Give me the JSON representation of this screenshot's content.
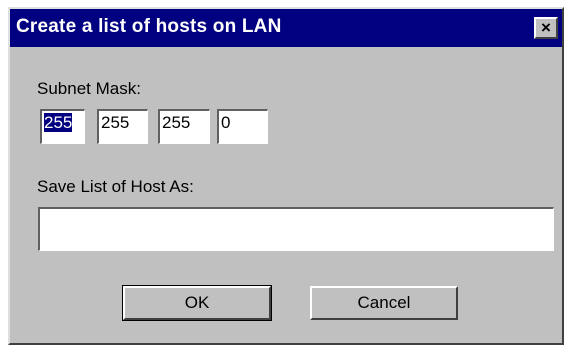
{
  "window": {
    "title": "Create a list of hosts on LAN",
    "close_glyph": "×",
    "close_icon": "close-icon"
  },
  "subnet": {
    "label": "Subnet Mask:",
    "octets": [
      "255",
      "255",
      "255",
      "0"
    ],
    "selected_octet": 1
  },
  "save": {
    "label": "Save List of Host As:",
    "value": ""
  },
  "buttons": {
    "ok": "OK",
    "cancel": "Cancel"
  },
  "colors": {
    "titlebar": "#000080",
    "face": "#c0c0c0",
    "selection": "#000080"
  }
}
